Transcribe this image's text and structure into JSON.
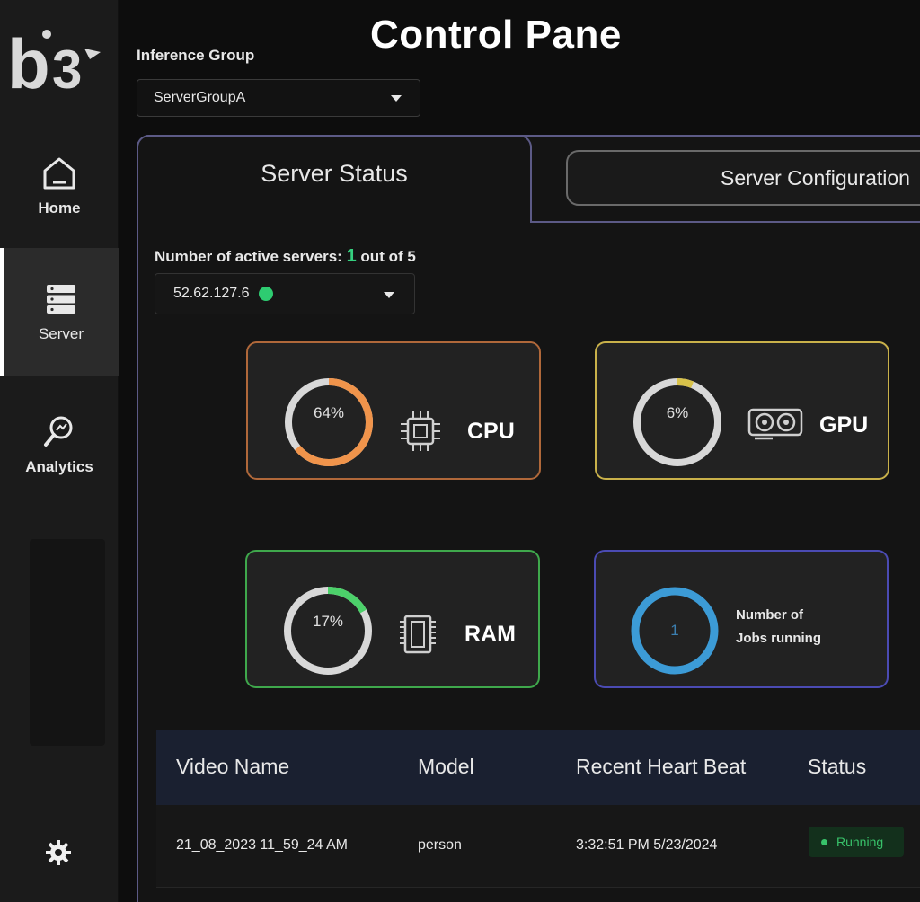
{
  "app": {
    "title": "Control Pane",
    "logo_text": "b3"
  },
  "sidebar": {
    "items": [
      {
        "label": "Home",
        "icon": "home-icon",
        "active": false
      },
      {
        "label": "Server",
        "icon": "server-icon",
        "active": true
      },
      {
        "label": "Analytics",
        "icon": "analytics-icon",
        "active": false
      }
    ],
    "settings_icon": "gear-icon"
  },
  "inference_group": {
    "label": "Inference Group",
    "selected": "ServerGroupA"
  },
  "tabs": [
    {
      "label": "Server Status",
      "active": true
    },
    {
      "label": "Server Configuration",
      "active": false
    }
  ],
  "servers": {
    "active_label": "Number of active servers:",
    "active_count": "1",
    "out_of_label": "out of",
    "total": "5",
    "selected_ip": "52.62.127.6",
    "selected_status_color": "#2ecc71"
  },
  "metrics": {
    "cpu": {
      "label": "CPU",
      "percent_text": "64%",
      "percent": 64,
      "color": "#f0944b"
    },
    "gpu": {
      "label": "GPU",
      "percent_text": "6%",
      "percent": 6,
      "color": "#d8c24a"
    },
    "ram": {
      "label": "RAM",
      "percent_text": "17%",
      "percent": 17,
      "color": "#4cd16a"
    },
    "jobs": {
      "label": "Number of Jobs running",
      "count": "1",
      "color": "#3c9bd6"
    }
  },
  "table": {
    "columns": [
      "Video Name",
      "Model",
      "Recent Heart Beat",
      "Status"
    ],
    "rows": [
      {
        "video_name": "21_08_2023 11_59_24 AM",
        "model": "person",
        "heartbeat": "3:32:51 PM 5/23/2024",
        "status": "Running"
      }
    ]
  }
}
